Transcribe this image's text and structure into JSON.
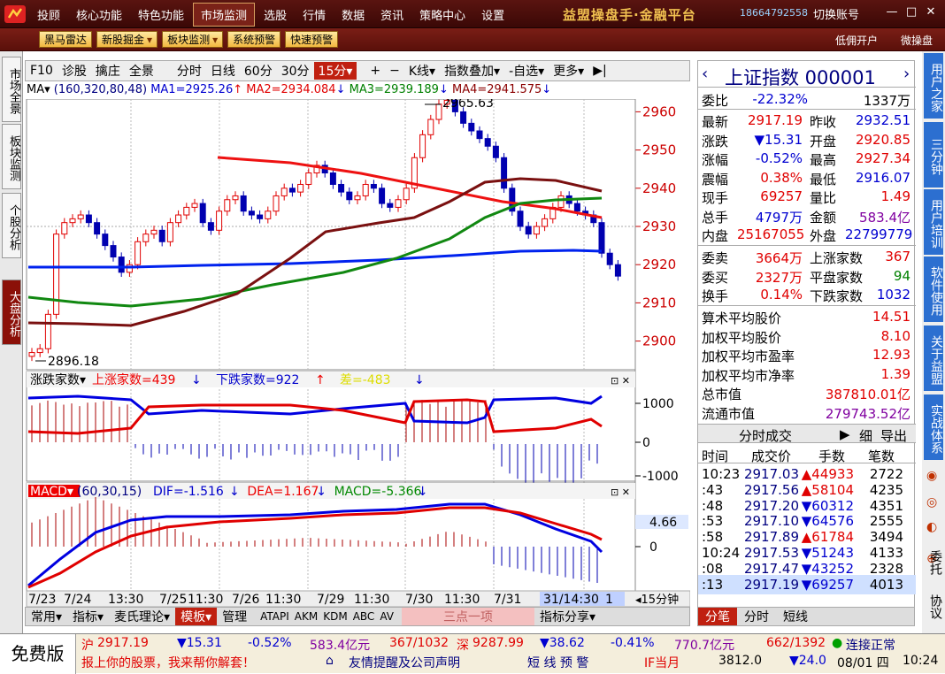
{
  "topbar": {
    "menu": [
      "投顾",
      "核心功能",
      "特色功能",
      "市场监测",
      "选股",
      "行情",
      "数据",
      "资讯",
      "策略中心",
      "设置"
    ],
    "active_menu": "市场监测",
    "brand": "益盟操盘手·金融平台",
    "phone": "18664792558",
    "account": "切换账号"
  },
  "toolbar2": {
    "buttons": [
      "黑马雷达",
      "新股掘金",
      "板块监测",
      "系统预警",
      "快速预警"
    ],
    "dropdown_buttons": [
      "新股掘金",
      "板块监测"
    ],
    "right": [
      "低佣开户",
      "微操盘"
    ]
  },
  "left_tabs": [
    "市场全景",
    "板块监测",
    "个股分析",
    "大盘分析"
  ],
  "chart_toolbar": [
    "F10",
    "诊股",
    "擒庄",
    "全景",
    "分时",
    "日线",
    "60分",
    "30分",
    "15分",
    "+",
    "−",
    "K线",
    "指数叠加",
    "自选",
    "更多"
  ],
  "ma": {
    "label": "MA",
    "params": "(160,320,80,48)",
    "ma1": "MA1=2925.26",
    "ma2": "MA2=2934.084",
    "ma3": "MA3=2939.189",
    "ma4": "MA4=2941.575"
  },
  "price_axis": [
    "2960",
    "2950",
    "2940",
    "2930",
    "2920",
    "2910",
    "2900"
  ],
  "high_label": "2965.63",
  "low_label": "2896.18",
  "updown": {
    "label": "涨跌家数",
    "up": "上涨家数=439",
    "down": "下跌家数=922",
    "diff": "差=-483",
    "axis": [
      "1000",
      "0",
      "-1000"
    ]
  },
  "macd": {
    "label": "MACD",
    "params": "(60,30,15)",
    "dif": "DIF=-1.516",
    "dea": "DEA=1.167",
    "macd": "MACD=-5.366",
    "axis": [
      "4.66",
      "0"
    ],
    "box_value": "4.66"
  },
  "time_axis": [
    "7/23",
    "7/24",
    "13:30",
    "7/25",
    "11:30",
    "7/26",
    "11:30",
    "7/29",
    "11:30",
    "7/30",
    "11:30",
    "7/31",
    "31/14:30",
    "1"
  ],
  "period": "15分钟",
  "bottom_tabs": [
    "常用",
    "指标",
    "麦氏理论",
    "模板",
    "管理",
    "ATAPI",
    "AKM",
    "KDM",
    "ABC",
    "AV",
    "三点一项",
    "指标分享"
  ],
  "right": {
    "title": "上证指数 000001",
    "weibi_label": "委比",
    "weibi": "-22.32%",
    "weibi_vol": "1337万",
    "rows": [
      [
        "最新",
        "2917.19",
        "昨收",
        "2932.51"
      ],
      [
        "涨跌",
        "▼15.31",
        "开盘",
        "2920.85"
      ],
      [
        "涨幅",
        "-0.52%",
        "最高",
        "2927.34"
      ],
      [
        "震幅",
        "0.38%",
        "最低",
        "2916.07"
      ],
      [
        "现手",
        "69257",
        "量比",
        "1.49"
      ],
      [
        "总手",
        "4797万",
        "金额",
        "583.4亿"
      ],
      [
        "内盘",
        "25167055",
        "外盘",
        "22799779"
      ]
    ],
    "rows2": [
      [
        "委卖",
        "3664万",
        "上涨家数",
        "367"
      ],
      [
        "委买",
        "2327万",
        "平盘家数",
        "94"
      ],
      [
        "换手",
        "0.14%",
        "下跌家数",
        "1032"
      ]
    ],
    "rows3": [
      [
        "算术平均股价",
        "14.51"
      ],
      [
        "加权平均股价",
        "8.10"
      ],
      [
        "加权平均市盈率",
        "12.93"
      ],
      [
        "加权平均市净率",
        "1.39"
      ],
      [
        "总市值",
        "387810.01亿"
      ],
      [
        "流通市值",
        "279743.52亿"
      ]
    ],
    "ticks_header": "分时成交",
    "ticks_btns": [
      "细",
      "导出"
    ],
    "ticks_cols": [
      "时间",
      "成交价",
      "手数",
      "笔数"
    ],
    "ticks": [
      [
        "10:23",
        "2917.03",
        "▲44933",
        "2722"
      ],
      [
        ":43",
        "2917.56",
        "▲58104",
        "4235"
      ],
      [
        ":48",
        "2917.20",
        "▼60312",
        "4351"
      ],
      [
        ":53",
        "2917.10",
        "▼64576",
        "2555"
      ],
      [
        ":58",
        "2917.89",
        "▲61784",
        "3494"
      ],
      [
        "10:24",
        "2917.53",
        "▼51243",
        "4133"
      ],
      [
        ":08",
        "2917.47",
        "▼43252",
        "2328"
      ],
      [
        ":13",
        "2917.19",
        "▼69257",
        "4013"
      ]
    ],
    "bottom_tabs": [
      "分笔",
      "分时",
      "短线"
    ]
  },
  "far_right_tabs": [
    "用户之家",
    "三分钟",
    "用户培训",
    "软件使用",
    "关于益盟",
    "实战体系"
  ],
  "far_right_small": [
    "委托",
    "协议"
  ],
  "status": {
    "free": "免费版",
    "sh_label": "沪",
    "sh": "2917.19",
    "sh_chg": "▼15.31",
    "sh_pct": "-0.52%",
    "sh_amt": "583.4亿元",
    "sh_ud": "367/1032",
    "sz_label": "深",
    "sz": "9287.99",
    "sz_chg": "▼38.62",
    "sz_pct": "-0.41%",
    "sz_amt": "770.7亿元",
    "sz_ud": "662/1392",
    "conn": "连接正常",
    "scroll": "报上你的股票，我来帮你解套！",
    "notice": "友情提醒及公司声明",
    "alert": "短 线 预 警",
    "if_label": "IF当月",
    "if_val": "3812.0",
    "if_chg": "▼24.0",
    "date": "08/01 四",
    "time": "10:24"
  },
  "colors": {
    "up": "#e00000",
    "down": "#0000d0",
    "ma1": "#0022ee",
    "ma2": "#ee1111",
    "ma3": "#118811",
    "ma4": "#7a1010",
    "brand": "#f0c050"
  }
}
